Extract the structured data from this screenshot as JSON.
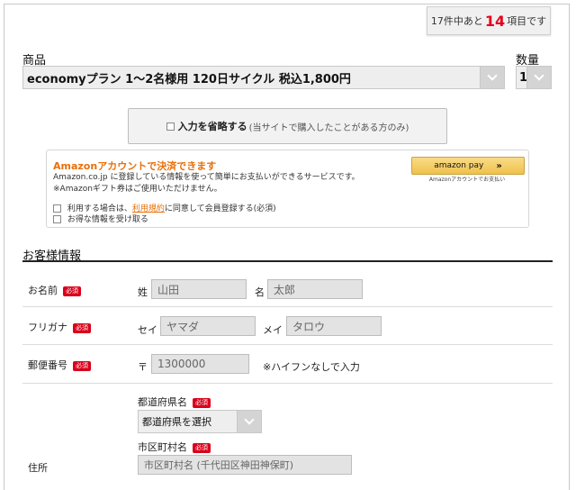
{
  "progress": {
    "prefix": "17件中あと",
    "count": "14",
    "suffix": "項目です"
  },
  "product": {
    "label": "商品",
    "selected": "economyプラン 1〜2名様用 120日サイクル 税込1,800円"
  },
  "quantity": {
    "label": "数量",
    "selected": "1"
  },
  "omit": {
    "label": "入力を省略する",
    "sub": "(当サイトで購入したことがある方のみ)"
  },
  "amazon": {
    "title": "Amazonアカウントで決済できます",
    "desc1": "Amazon.co.jp に登録している情報を使って簡単にお支払いができるサービスです。",
    "desc2": "※Amazonギフト券はご使用いただけません。",
    "consent_pre": "利用する場合は、",
    "consent_link": "利用規約",
    "consent_post": "に同意して会員登録する(必須)",
    "newsletter": "お得な情報を受け取る",
    "pay_button": "amazon pay",
    "pay_arrow": "»",
    "pay_sub": "Amazonアカウントでお支払い"
  },
  "customer": {
    "section_title": "お客様情報",
    "required_badge": "必須",
    "name": {
      "label": "お名前",
      "last_label": "姓",
      "last_placeholder": "山田",
      "first_label": "名",
      "first_placeholder": "太郎"
    },
    "kana": {
      "label": "フリガナ",
      "last_label": "セイ",
      "last_placeholder": "ヤマダ",
      "first_label": "メイ",
      "first_placeholder": "タロウ"
    },
    "zip": {
      "label": "郵便番号",
      "prefix": "〒",
      "placeholder": "1300000",
      "note": "※ハイフンなしで入力"
    },
    "address": {
      "label": "住所",
      "pref_label": "都道府県名",
      "pref_selected": "都道府県を選択",
      "city_label": "市区町村名",
      "city_placeholder": "市区町村名 (千代田区神田神保町)"
    }
  }
}
